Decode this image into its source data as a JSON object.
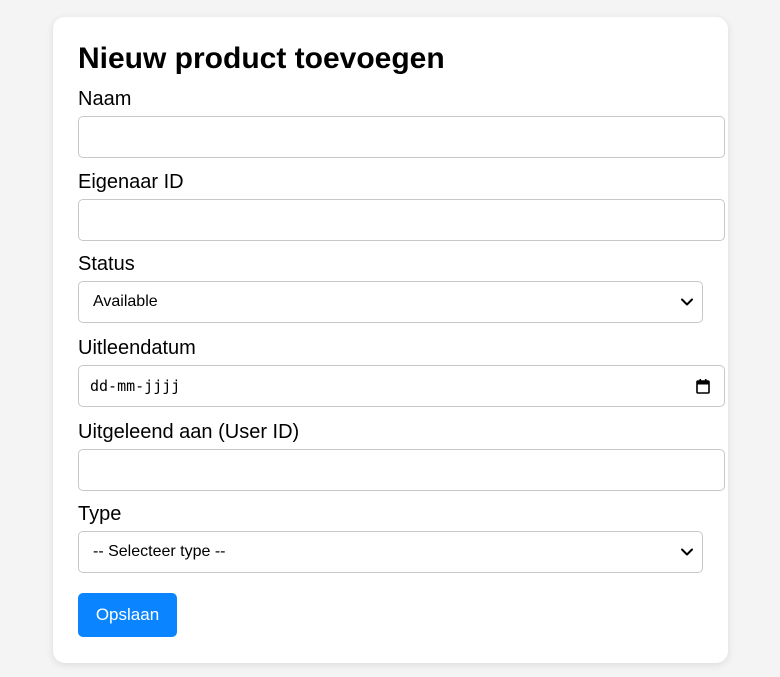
{
  "form": {
    "title": "Nieuw product toevoegen",
    "fields": {
      "naam": {
        "label": "Naam",
        "value": ""
      },
      "eigenaar": {
        "label": "Eigenaar ID",
        "value": ""
      },
      "status": {
        "label": "Status",
        "selected": "Available"
      },
      "uitleendatum": {
        "label": "Uitleendatum",
        "placeholder": "dd-mm-jjjj"
      },
      "uitgeleend": {
        "label": "Uitgeleend aan (User ID)",
        "value": ""
      },
      "type": {
        "label": "Type",
        "selected": "-- Selecteer type --"
      }
    },
    "submit_label": "Opslaan"
  },
  "colors": {
    "accent": "#0a84ff",
    "background": "#f4f4f4",
    "card": "#ffffff"
  },
  "icons": {
    "select": "chevron-down-icon",
    "date": "calendar-icon"
  }
}
